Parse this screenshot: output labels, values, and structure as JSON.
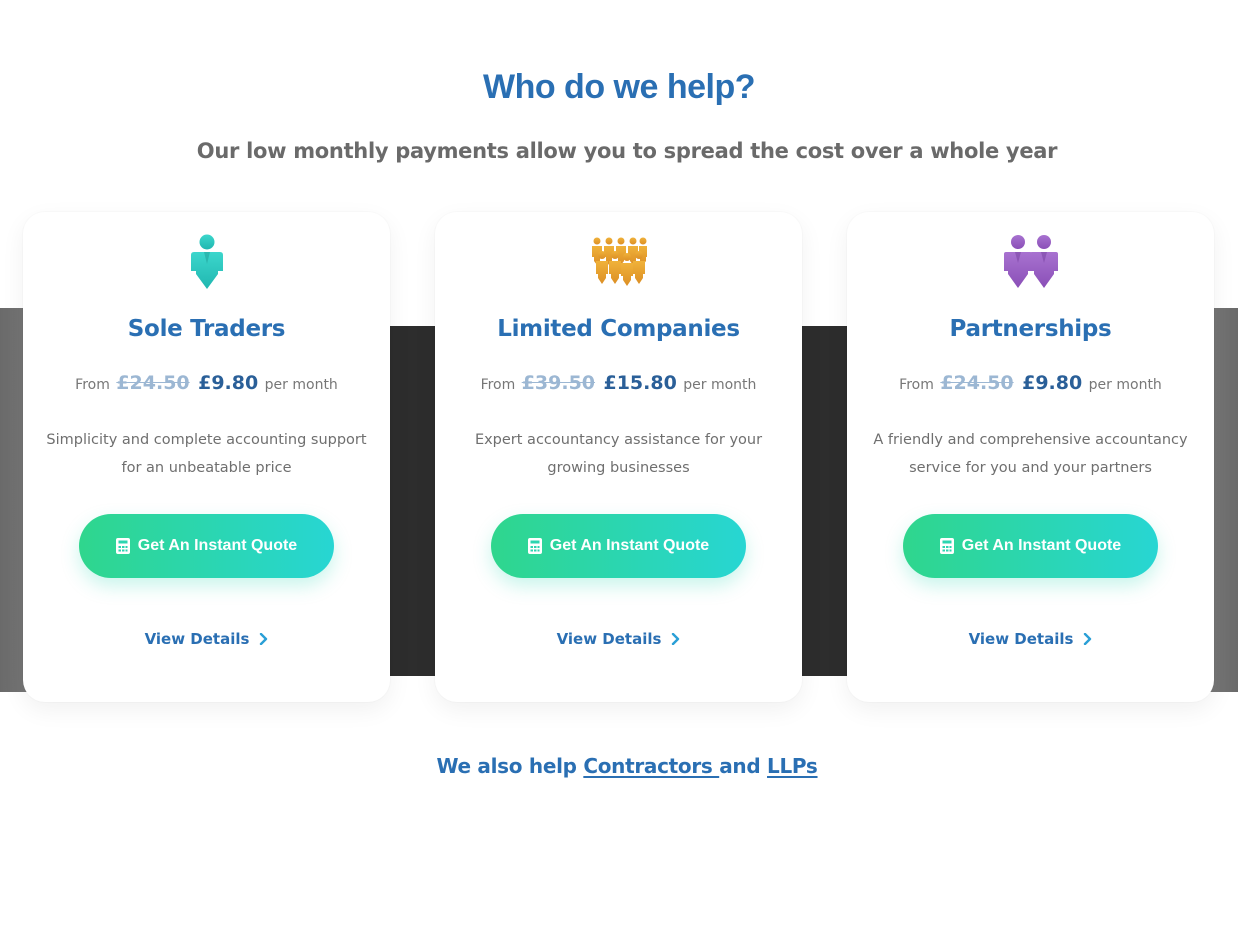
{
  "section": {
    "title": "Who do we help?",
    "subtitle": "Our low monthly payments allow you to spread the cost over a whole year"
  },
  "cards": [
    {
      "title": "Sole Traders",
      "icon": "person-icon",
      "icon_color": "#2fcfc5",
      "from_label": "From",
      "old_price": "£24.50",
      "new_price": "£9.80",
      "period": "per month",
      "description": "Simplicity and complete accounting support for an unbeatable price",
      "cta_label": "Get An Instant Quote",
      "details_label": "View Details"
    },
    {
      "title": "Limited Companies",
      "icon": "group-icon",
      "icon_color": "#e8a22f",
      "from_label": "From",
      "old_price": "£39.50",
      "new_price": "£15.80",
      "period": "per month",
      "description": "Expert accountancy assistance for your growing businesses",
      "cta_label": "Get An Instant Quote",
      "details_label": "View Details"
    },
    {
      "title": "Partnerships",
      "icon": "two-people-icon",
      "icon_color": "#9b5fc4",
      "from_label": "From",
      "old_price": "£24.50",
      "new_price": "£9.80",
      "period": "per month",
      "description": "A friendly and comprehensive accountancy service for you and your partners",
      "cta_label": "Get An Instant Quote",
      "details_label": "View Details"
    }
  ],
  "footer_line": {
    "prefix": "We also help ",
    "link1": "Contractors ",
    "middle": "and ",
    "link2": "LLPs"
  },
  "colors": {
    "heading": "#2a6fb3",
    "button_start": "#2fd68d",
    "button_end": "#27d6d3"
  }
}
